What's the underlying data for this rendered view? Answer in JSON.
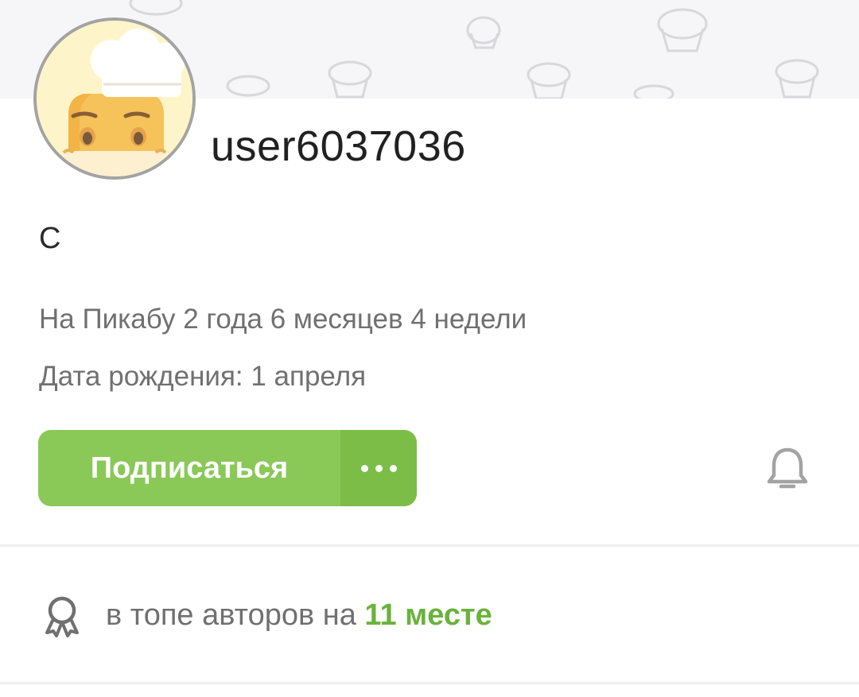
{
  "profile": {
    "username": "user6037036",
    "bio": "С",
    "on_site": "На Пикабу 2 года 6 месяцев 4 недели",
    "birthday": "Дата рождения: 1 апреля"
  },
  "actions": {
    "subscribe_label": "Подписаться",
    "more_icon": "more-dots-icon",
    "bell_icon": "bell-icon"
  },
  "rank": {
    "icon": "award-ribbon-icon",
    "text": "в топе авторов на",
    "place": "11 месте"
  },
  "colors": {
    "accent": "#8ac858",
    "accent_dark": "#7cbd47",
    "rank_highlight": "#6ab23c"
  }
}
